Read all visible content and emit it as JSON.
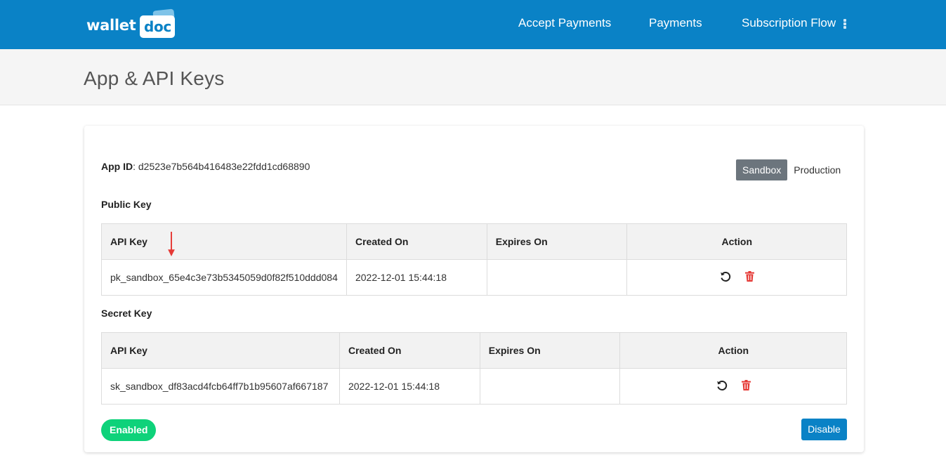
{
  "brand": {
    "word": "wallet",
    "badge": "doc"
  },
  "nav": {
    "items": [
      "Accept Payments",
      "Payments",
      "Subscription Flow"
    ],
    "more_icon": "kebab-vertical-icon"
  },
  "page": {
    "title": "App & API Keys"
  },
  "app": {
    "id_label": "App ID",
    "id_value": "d2523e7b564b416483e22fdd1cd68890"
  },
  "environment": {
    "active": "Sandbox",
    "inactive": "Production"
  },
  "public_key": {
    "section_label": "Public Key",
    "headers": [
      "API Key",
      "Created On",
      "Expires On",
      "Action"
    ],
    "row": {
      "api_key": "pk_sandbox_65e4c3e73b5345059d0f82f510ddd084",
      "created_on": "2022-12-01 15:44:18",
      "expires_on": ""
    }
  },
  "secret_key": {
    "section_label": "Secret Key",
    "headers": [
      "API Key",
      "Created On",
      "Expires On",
      "Action"
    ],
    "row": {
      "api_key": "sk_sandbox_df83acd4fcb64ff7b1b95607af667187",
      "created_on": "2022-12-01 15:44:18",
      "expires_on": ""
    }
  },
  "status": {
    "badge": "Enabled",
    "action_button": "Disable"
  },
  "icons": {
    "regenerate": "refresh-icon",
    "delete": "trash-icon",
    "annotation": "red-arrow-icon"
  },
  "colors": {
    "header": "#0a82c6",
    "enabled": "#0ed27a",
    "delete": "#e53935",
    "annotation_arrow": "#e53935",
    "sandbox_bg": "#6c757d"
  }
}
